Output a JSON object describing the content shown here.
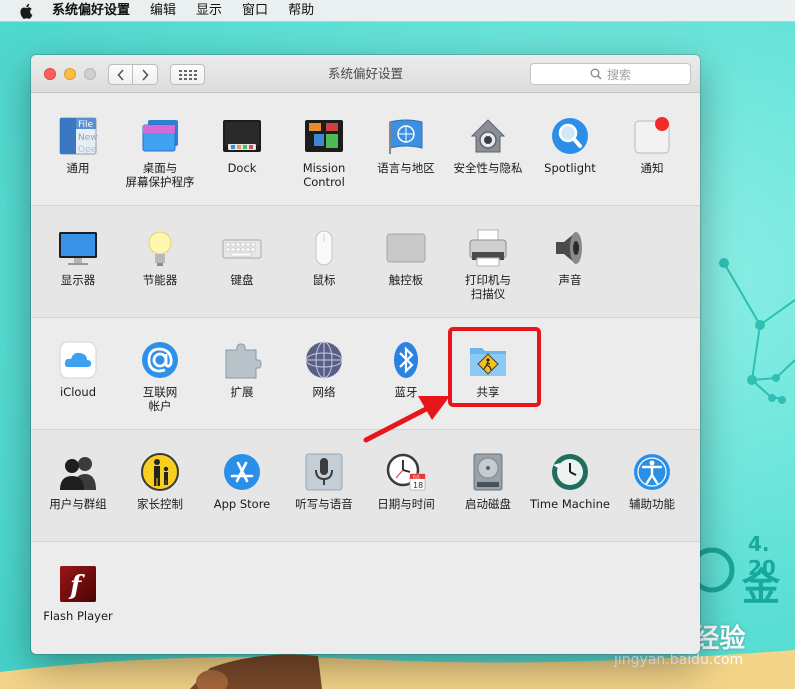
{
  "menubar": {
    "app_name": "系统偏好设置",
    "items": [
      "编辑",
      "显示",
      "窗口",
      "帮助"
    ],
    "apple_icon": "apple-icon"
  },
  "window": {
    "title": "系统偏好设置",
    "search_placeholder": "搜索",
    "nav_back_icon": "chevron-left-icon",
    "nav_forward_icon": "chevron-right-icon",
    "grid_icon": "grid-icon"
  },
  "sections": [
    {
      "panes": [
        {
          "id": "general",
          "label": "通用",
          "icon": "general-icon"
        },
        {
          "id": "desktop",
          "label": "桌面与\n屏幕保护程序",
          "icon": "desktop-screensaver-icon"
        },
        {
          "id": "dock",
          "label": "Dock",
          "icon": "dock-icon"
        },
        {
          "id": "mission-control",
          "label": "Mission\nControl",
          "icon": "mission-control-icon"
        },
        {
          "id": "language",
          "label": "语言与地区",
          "icon": "un-flag-icon"
        },
        {
          "id": "security",
          "label": "安全性与隐私",
          "icon": "house-lock-icon"
        },
        {
          "id": "spotlight",
          "label": "Spotlight",
          "icon": "magnifier-icon"
        },
        {
          "id": "notifications",
          "label": "通知",
          "icon": "notifications-icon"
        }
      ]
    },
    {
      "panes": [
        {
          "id": "displays",
          "label": "显示器",
          "icon": "monitor-icon"
        },
        {
          "id": "energy",
          "label": "节能器",
          "icon": "lightbulb-icon"
        },
        {
          "id": "keyboard",
          "label": "键盘",
          "icon": "keyboard-icon"
        },
        {
          "id": "mouse",
          "label": "鼠标",
          "icon": "mouse-icon"
        },
        {
          "id": "trackpad",
          "label": "触控板",
          "icon": "trackpad-icon"
        },
        {
          "id": "printers",
          "label": "打印机与\n扫描仪",
          "icon": "printer-icon"
        },
        {
          "id": "sound",
          "label": "声音",
          "icon": "speaker-icon"
        }
      ]
    },
    {
      "panes": [
        {
          "id": "icloud",
          "label": "iCloud",
          "icon": "icloud-icon"
        },
        {
          "id": "internet-accounts",
          "label": "互联网\n帐户",
          "icon": "at-sign-icon"
        },
        {
          "id": "extensions",
          "label": "扩展",
          "icon": "puzzle-icon"
        },
        {
          "id": "network",
          "label": "网络",
          "icon": "globe-icon"
        },
        {
          "id": "bluetooth",
          "label": "蓝牙",
          "icon": "bluetooth-icon"
        },
        {
          "id": "sharing",
          "label": "共享",
          "icon": "sharing-folder-icon"
        }
      ]
    },
    {
      "panes": [
        {
          "id": "users",
          "label": "用户与群组",
          "icon": "users-icon"
        },
        {
          "id": "parental",
          "label": "家长控制",
          "icon": "parental-controls-icon"
        },
        {
          "id": "app-store",
          "label": "App Store",
          "icon": "app-store-icon"
        },
        {
          "id": "dictation",
          "label": "听写与语音",
          "icon": "microphone-icon"
        },
        {
          "id": "date-time",
          "label": "日期与时间",
          "icon": "clock-calendar-icon"
        },
        {
          "id": "startup-disk",
          "label": "启动磁盘",
          "icon": "hard-drive-icon"
        },
        {
          "id": "time-machine",
          "label": "Time Machine",
          "icon": "time-machine-icon"
        },
        {
          "id": "accessibility",
          "label": "辅助功能",
          "icon": "accessibility-icon"
        }
      ]
    },
    {
      "panes": [
        {
          "id": "flash",
          "label": "Flash Player",
          "icon": "flash-player-icon"
        }
      ]
    }
  ],
  "icon_text": {
    "general_file": "File",
    "general_new": "New",
    "general_ope": "Ope",
    "calendar_month": "JUL",
    "calendar_day": "18",
    "flash_letter": "f"
  },
  "wallpaper": {
    "date_text": "4. 20",
    "big_char": "金",
    "watermark_brand": "Baidu经验",
    "watermark_url": "jingyan.baidu.com"
  },
  "colors": {
    "highlight": "#e8151a",
    "wallpaper": "#5fe0d8"
  }
}
